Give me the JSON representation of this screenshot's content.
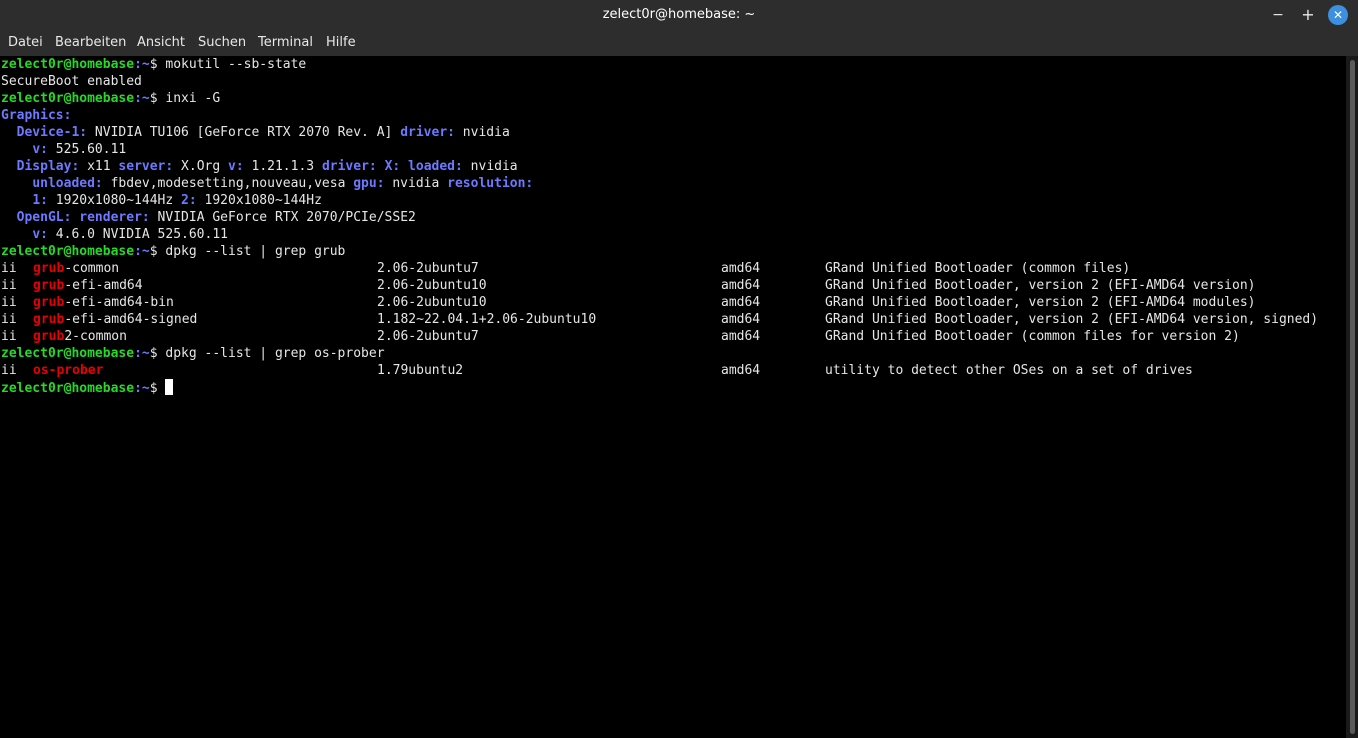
{
  "window": {
    "title": "zelect0r@homebase: ~",
    "min_glyph": "−",
    "max_glyph": "+",
    "close_glyph": "✕"
  },
  "menu": [
    "Datei",
    "Bearbeiten",
    "Ansicht",
    "Suchen",
    "Terminal",
    "Hilfe"
  ],
  "prompt": {
    "user": "zelect0r@homebase",
    "path": ":~",
    "sign": "$ "
  },
  "commands": {
    "c1": "mokutil --sb-state",
    "c2": "inxi -G",
    "c3": "dpkg --list | grep grub",
    "c4": "dpkg --list | grep os-prober"
  },
  "output": {
    "secureboot": "SecureBoot enabled",
    "graphics_label": "Graphics:",
    "device_key": "Device-1:",
    "device_val": " NVIDIA TU106 [GeForce RTX 2070 Rev. A] ",
    "driver_key": "driver:",
    "driver_val": " nvidia",
    "v_key": "v:",
    "v_val": " 525.60.11",
    "display_key": "Display:",
    "display_val": " x11 ",
    "server_key": "server:",
    "server_val": " X.Org ",
    "v2_key": "v:",
    "v2_val": " 1.21.1.3 ",
    "driver2_key": "driver: X: loaded:",
    "driver2_val": " nvidia",
    "unloaded_key": "unloaded:",
    "unloaded_val": " fbdev,modesetting,nouveau,vesa ",
    "gpu_key": "gpu:",
    "gpu_val": " nvidia ",
    "resolution_key": "resolution:",
    "res1_key": "1:",
    "res1_val": " 1920x1080~144Hz ",
    "res2_key": "2:",
    "res2_val": " 1920x1080~144Hz",
    "opengl_key": "OpenGL:",
    "renderer_key": "renderer:",
    "renderer_val": " NVIDIA GeForce RTX 2070/PCIe/SSE2",
    "v3_key": "v:",
    "v3_val": " 4.6.0 NVIDIA 525.60.11"
  },
  "packages": [
    {
      "status": "ii",
      "match": "grub",
      "rest": "-common",
      "version": "2.06-2ubuntu7",
      "arch": "amd64",
      "desc": "GRand Unified Bootloader (common files)"
    },
    {
      "status": "ii",
      "match": "grub",
      "rest": "-efi-amd64",
      "version": "2.06-2ubuntu10",
      "arch": "amd64",
      "desc": "GRand Unified Bootloader, version 2 (EFI-AMD64 version)"
    },
    {
      "status": "ii",
      "match": "grub",
      "rest": "-efi-amd64-bin",
      "version": "2.06-2ubuntu10",
      "arch": "amd64",
      "desc": "GRand Unified Bootloader, version 2 (EFI-AMD64 modules)"
    },
    {
      "status": "ii",
      "match": "grub",
      "rest": "-efi-amd64-signed",
      "version": "1.182~22.04.1+2.06-2ubuntu10",
      "arch": "amd64",
      "desc": "GRand Unified Bootloader, version 2 (EFI-AMD64 version, signed)"
    },
    {
      "status": "ii",
      "match": "grub",
      "rest": "2-common",
      "version": "2.06-2ubuntu7",
      "arch": "amd64",
      "desc": "GRand Unified Bootloader (common files for version 2)"
    },
    {
      "status": "ii",
      "match": "os-prober",
      "rest": "",
      "version": "1.79ubuntu2",
      "arch": "amd64",
      "desc": "utility to detect other OSes on a set of drives"
    }
  ]
}
